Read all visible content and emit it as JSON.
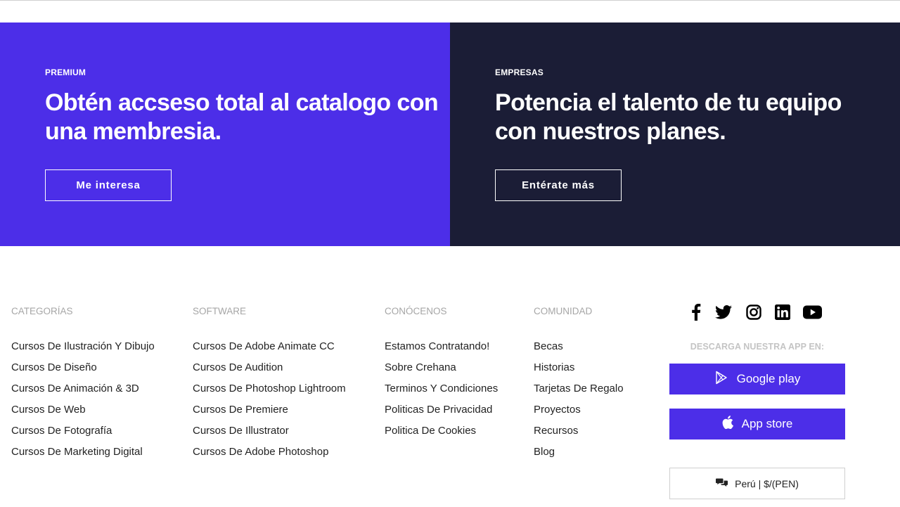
{
  "promo": {
    "premium": {
      "kicker": "PREMIUM",
      "title": "Obtén accseso total al catalogo con una membresia.",
      "button": "Me interesa"
    },
    "business": {
      "kicker": "EMPRESAS",
      "title": "Potencia el talento de tu equipo con nuestros planes.",
      "button": "Entérate más"
    }
  },
  "footer": {
    "categories": {
      "heading": "CATEGORÍAS",
      "items": [
        "Cursos De Ilustración Y Dibujo",
        "Cursos De Diseño",
        "Cursos De Animación & 3D",
        "Cursos De Web",
        "Cursos De Fotografía",
        "Cursos De Marketing Digital"
      ]
    },
    "software": {
      "heading": "SOFTWARE",
      "items": [
        "Cursos De Adobe Animate CC",
        "Cursos De Audition",
        "Cursos De Photoshop Lightroom",
        "Cursos De Premiere",
        "Cursos De Illustrator",
        "Cursos De Adobe Photoshop"
      ]
    },
    "about": {
      "heading": "CONÓCENOS",
      "items": [
        "Estamos Contratando!",
        "Sobre Crehana",
        "Terminos Y Condiciones",
        "Politicas De Privacidad",
        "Politica De Cookies"
      ]
    },
    "community": {
      "heading": "COMUNIDAD",
      "items": [
        "Becas",
        "Historias",
        "Tarjetas De Regalo",
        "Proyectos",
        "Recursos",
        "Blog"
      ]
    },
    "social_icons": [
      "facebook-icon",
      "twitter-icon",
      "instagram-icon",
      "linkedin-icon",
      "youtube-icon"
    ],
    "download_label": "DESCARGA NUESTRA APP EN:",
    "google_play": "Google play",
    "app_store": "App store",
    "locale": "Perú | $/(PEN)"
  },
  "colors": {
    "premium_bg": "#4c2ee8",
    "business_bg": "#1b1d36",
    "accent": "#4c2ee8",
    "heading_gray": "#a6a6a6"
  }
}
